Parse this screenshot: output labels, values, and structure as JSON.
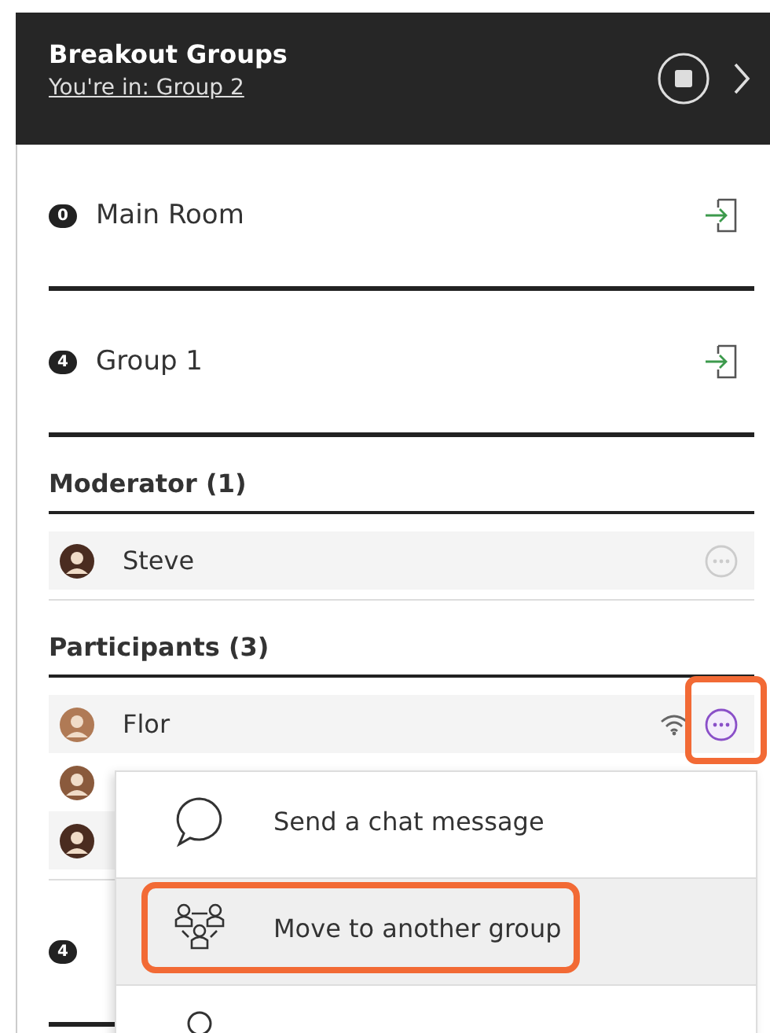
{
  "header": {
    "title": "Breakout Groups",
    "subtitle": "You're in: Group 2"
  },
  "rooms": [
    {
      "count": "0",
      "name": "Main Room"
    },
    {
      "count": "4",
      "name": "Group 1",
      "sections": [
        {
          "heading": "Moderator (1)",
          "people": [
            {
              "name": "Steve",
              "menu_open": false,
              "highlighted": false,
              "connection_icon": false
            }
          ]
        },
        {
          "heading": "Participants (3)",
          "people": [
            {
              "name": "Flor",
              "menu_open": true,
              "highlighted": true,
              "connection_icon": true
            },
            {
              "highlighted": false,
              "connection_icon": false
            },
            {
              "highlighted": false,
              "connection_icon": false
            }
          ]
        }
      ]
    },
    {
      "count": "4"
    }
  ],
  "menu": {
    "items": [
      {
        "kind": "chat",
        "label": "Send a chat message",
        "selected": false,
        "highlighted": false
      },
      {
        "kind": "move",
        "label": "Move to another group",
        "selected": true,
        "highlighted": true
      },
      {
        "kind": "moderator",
        "selected": false,
        "highlighted": false
      }
    ]
  }
}
